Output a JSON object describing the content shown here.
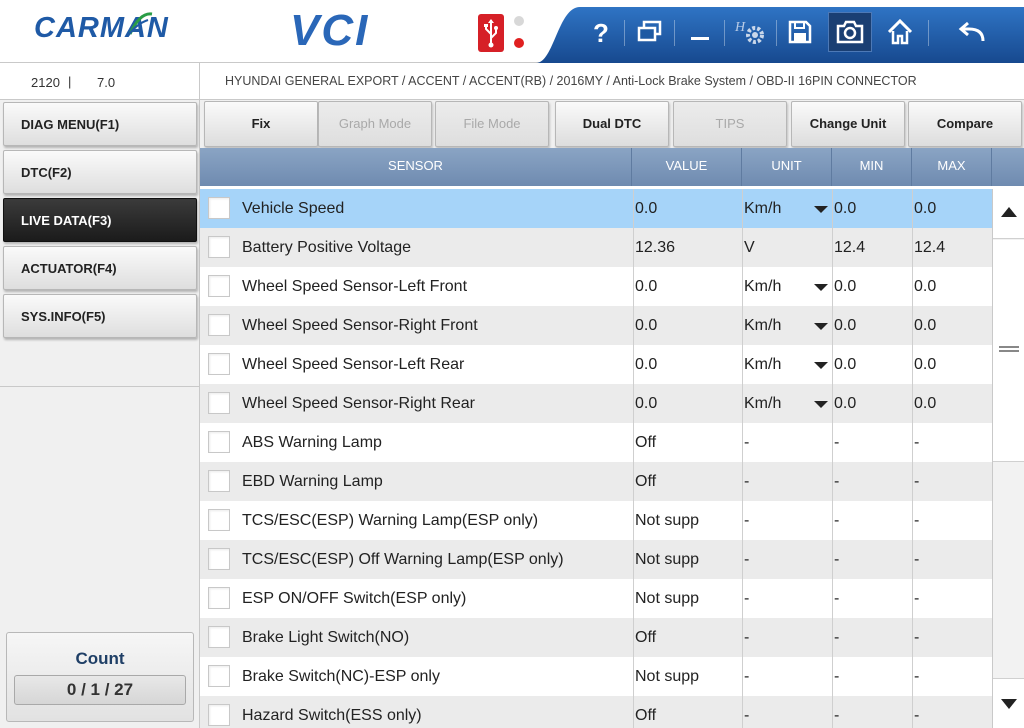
{
  "header": {
    "logo": "CARMAN",
    "product": "VCI"
  },
  "info": {
    "code": "2120",
    "separator": "|",
    "version": "7.0",
    "path": "HYUNDAI GENERAL EXPORT / ACCENT / ACCENT(RB) / 2016MY / Anti-Lock Brake System / OBD-II 16PIN CONNECTOR"
  },
  "sidebar": {
    "items": [
      {
        "label": "DIAG MENU(F1)",
        "active": false
      },
      {
        "label": "DTC(F2)",
        "active": false
      },
      {
        "label": "LIVE DATA(F3)",
        "active": true
      },
      {
        "label": "ACTUATOR(F4)",
        "active": false
      },
      {
        "label": "SYS.INFO(F5)",
        "active": false
      }
    ],
    "count_label": "Count",
    "count_value": "0 / 1 / 27"
  },
  "function_bar": {
    "buttons": [
      {
        "label": "Fix",
        "enabled": true
      },
      {
        "label": "Graph Mode",
        "enabled": false
      },
      {
        "label": "File Mode",
        "enabled": false
      },
      {
        "label": "Dual DTC",
        "enabled": true
      },
      {
        "label": "TIPS",
        "enabled": false
      },
      {
        "label": "Change Unit",
        "enabled": true
      },
      {
        "label": "Compare",
        "enabled": true
      }
    ]
  },
  "table": {
    "columns": [
      "SENSOR",
      "VALUE",
      "UNIT",
      "MIN",
      "MAX"
    ],
    "rows": [
      {
        "sensor": "Vehicle Speed",
        "value": "0.0",
        "unit": "Km/h",
        "min": "0.0",
        "max": "0.0",
        "dropdown": true,
        "selected": true
      },
      {
        "sensor": "Battery Positive Voltage",
        "value": "12.36",
        "unit": "V",
        "min": "12.4",
        "max": "12.4",
        "dropdown": false,
        "selected": false
      },
      {
        "sensor": "Wheel Speed Sensor-Left Front",
        "value": "0.0",
        "unit": "Km/h",
        "min": "0.0",
        "max": "0.0",
        "dropdown": true,
        "selected": false
      },
      {
        "sensor": "Wheel Speed Sensor-Right Front",
        "value": "0.0",
        "unit": "Km/h",
        "min": "0.0",
        "max": "0.0",
        "dropdown": true,
        "selected": false
      },
      {
        "sensor": "Wheel Speed Sensor-Left Rear",
        "value": "0.0",
        "unit": "Km/h",
        "min": "0.0",
        "max": "0.0",
        "dropdown": true,
        "selected": false
      },
      {
        "sensor": "Wheel Speed Sensor-Right Rear",
        "value": "0.0",
        "unit": "Km/h",
        "min": "0.0",
        "max": "0.0",
        "dropdown": true,
        "selected": false
      },
      {
        "sensor": "ABS Warning Lamp",
        "value": "Off",
        "unit": "-",
        "min": "-",
        "max": "-",
        "dropdown": false,
        "selected": false
      },
      {
        "sensor": "EBD Warning Lamp",
        "value": "Off",
        "unit": "-",
        "min": "-",
        "max": "-",
        "dropdown": false,
        "selected": false
      },
      {
        "sensor": "TCS/ESC(ESP) Warning Lamp(ESP only)",
        "value": "Not supp",
        "unit": "-",
        "min": "-",
        "max": "-",
        "dropdown": false,
        "selected": false
      },
      {
        "sensor": "TCS/ESC(ESP) Off Warning Lamp(ESP only)",
        "value": "Not supp",
        "unit": "-",
        "min": "-",
        "max": "-",
        "dropdown": false,
        "selected": false
      },
      {
        "sensor": "ESP ON/OFF Switch(ESP only)",
        "value": "Not supp",
        "unit": "-",
        "min": "-",
        "max": "-",
        "dropdown": false,
        "selected": false
      },
      {
        "sensor": "Brake Light Switch(NO)",
        "value": "Off",
        "unit": "-",
        "min": "-",
        "max": "-",
        "dropdown": false,
        "selected": false
      },
      {
        "sensor": "Brake Switch(NC)-ESP only",
        "value": "Not supp",
        "unit": "-",
        "min": "-",
        "max": "-",
        "dropdown": false,
        "selected": false
      },
      {
        "sensor": "Hazard Switch(ESS only)",
        "value": "Off",
        "unit": "-",
        "min": "-",
        "max": "-",
        "dropdown": false,
        "selected": false
      }
    ]
  },
  "toolbar_icons": [
    "help-icon",
    "window-icon",
    "minimize-icon",
    "settings-icon",
    "save-icon",
    "camera-icon",
    "home-icon",
    "back-icon"
  ],
  "colors": {
    "brand_blue": "#1f5aa6",
    "toolbar_blue": "#1e5aa3",
    "selected_row": "#a6d4f9",
    "header_row": "#7f9bbd",
    "usb_red": "#d62027"
  }
}
